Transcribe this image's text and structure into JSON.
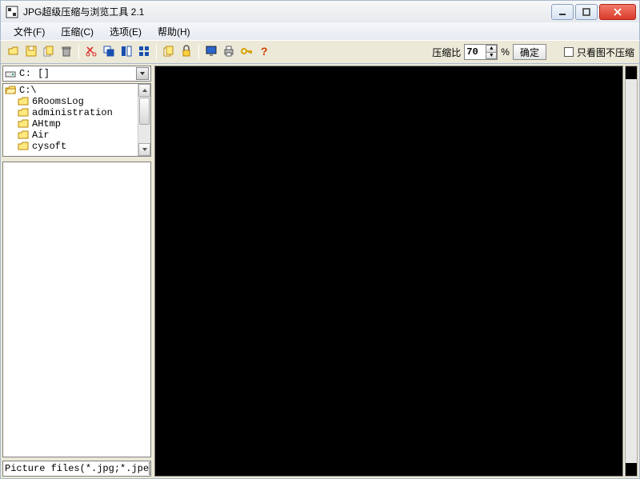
{
  "window": {
    "title": "JPG超级压缩与浏览工具 2.1"
  },
  "menu": {
    "file": "文件(F)",
    "compress": "压缩(C)",
    "options": "选项(E)",
    "help": "帮助(H)"
  },
  "toolbar": {
    "icons": {
      "open": "open-icon",
      "save": "save-icon",
      "copy": "copy-icon",
      "delete": "delete-icon",
      "cut": "cut-icon",
      "thumb1": "thumb-icon",
      "thumb2": "thumb2-icon",
      "grid": "grid-icon",
      "copy2": "copy2-icon",
      "lock": "lock-icon",
      "monitor": "monitor-icon",
      "print": "print-icon",
      "key": "key-icon",
      "help": "help-icon"
    },
    "ratio_label": "压缩比",
    "ratio_value": "70",
    "ratio_suffix": "%",
    "confirm": "确定",
    "view_only_checkbox": "只看图不压缩"
  },
  "left": {
    "drive": "C: []",
    "tree": {
      "root": "C:\\",
      "folders": [
        "6RoomsLog",
        "administration",
        "AHtmp",
        "Air",
        "cysoft"
      ]
    },
    "filetype": "Picture files(*.jpg;*.jpe"
  }
}
